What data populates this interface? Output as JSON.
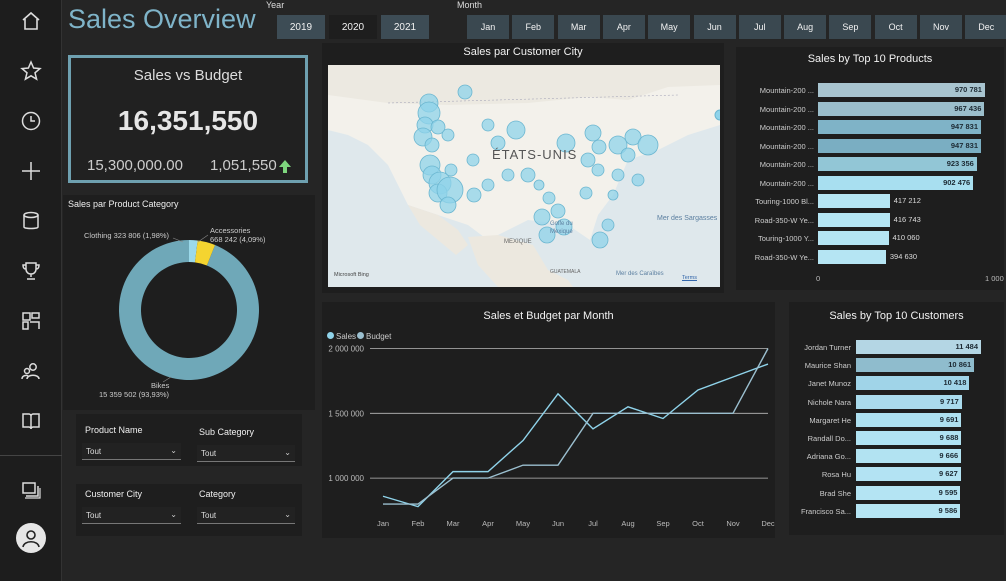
{
  "title": "Sales Overview",
  "filters": {
    "year_label": "Year",
    "years": [
      "2019",
      "2020",
      "2021"
    ],
    "month_label": "Month",
    "months": [
      "Jan",
      "Feb",
      "Mar",
      "Apr",
      "May",
      "Jun",
      "Jul",
      "Aug",
      "Sep",
      "Oct",
      "Nov",
      "Dec"
    ]
  },
  "kpi": {
    "title": "Sales vs Budget",
    "value": "16,351,550",
    "budget": "15,300,000.00",
    "delta": "1,051,550",
    "delta_color": "#7ed67e"
  },
  "map": {
    "title": "Sales par Customer City",
    "country_label": "ÉTATS-UNIS",
    "labels": {
      "mexico": "MEXIQUE",
      "gulf": "Golfe du Mexique",
      "sargasso": "Mer des Sargasses",
      "caribbean": "Mer des Caraïbes",
      "guatemala": "GUATEMALA",
      "brand": "Microsoft Bing",
      "terms": "Terms"
    },
    "bubble_color": "#8fd3ea"
  },
  "donut": {
    "title": "Sales par Product Category",
    "labels": {
      "clothing": "Clothing 323 806 (1,98%)",
      "accessories_name": "Accessories",
      "accessories_value": "668 242 (4,09%)",
      "bikes_name": "Bikes",
      "bikes_value": "15 359 502 (93,93%)"
    }
  },
  "slicers": [
    {
      "label": "Product Name",
      "value": "Tout"
    },
    {
      "label": "Sub Category",
      "value": "Tout"
    },
    {
      "label": "Customer City",
      "value": "Tout"
    },
    {
      "label": "Category",
      "value": "Tout"
    }
  ],
  "line_title": "Sales et Budget par Month",
  "legend": {
    "sales": "Sales",
    "budget": "Budget"
  },
  "top_products": {
    "title": "Sales by Top 10 Products",
    "axis_labels": [
      "0",
      "1 000"
    ]
  },
  "top_customers": {
    "title": "Sales by Top 10 Customers"
  },
  "colors": {
    "accent_bar_dark": "#a8c4cf",
    "accent_bar_light": "#a8dff0",
    "kpi_border": "#6ea0b0",
    "donut_bikes": "#6fa8b8",
    "donut_accessories": "#f4d430",
    "donut_clothing": "#9bd9ea",
    "line_sales": "#8fd3ea",
    "line_budget": "#9bbfcf"
  },
  "chart_data": [
    {
      "type": "pie",
      "title": "Sales par Product Category",
      "categories": [
        "Bikes",
        "Accessories",
        "Clothing"
      ],
      "values": [
        15359502,
        668242,
        323806
      ],
      "percent": [
        93.93,
        4.09,
        1.98
      ]
    },
    {
      "type": "line",
      "title": "Sales et Budget par Month",
      "categories": [
        "Jan",
        "Feb",
        "Mar",
        "Apr",
        "May",
        "Jun",
        "Jul",
        "Aug",
        "Sep",
        "Oct",
        "Nov",
        "Dec"
      ],
      "series": [
        {
          "name": "Sales",
          "values": [
            860000,
            780000,
            1050000,
            1050000,
            1290000,
            1650000,
            1380000,
            1550000,
            1460000,
            1680000,
            1780000,
            1880000
          ]
        },
        {
          "name": "Budget",
          "values": [
            800000,
            800000,
            1000000,
            1000000,
            1100000,
            1100000,
            1500000,
            1500000,
            1500000,
            1500000,
            1500000,
            2000000
          ]
        }
      ],
      "y_ticks": [
        "1 000 000",
        "1 500 000",
        "2 000 000"
      ],
      "y_tick_values": [
        1000000,
        1500000,
        2000000
      ],
      "ylim": [
        700000,
        2050000
      ]
    },
    {
      "type": "bar",
      "title": "Sales by Top 10 Products",
      "categories": [
        "Mountain-200 ...",
        "Mountain-200 ...",
        "Mountain-200 ...",
        "Mountain-200 ...",
        "Mountain-200 ...",
        "Mountain-200 ...",
        "Touring-1000 Bl...",
        "Road-350-W Ye...",
        "Touring-1000 Y...",
        "Road-350-W Ye..."
      ],
      "values": [
        970781,
        967436,
        947831,
        947831,
        923356,
        902476,
        417212,
        416743,
        410060,
        394630
      ],
      "value_labels": [
        "970 781",
        "967 436",
        "947 831",
        "947 831",
        "923 356",
        "902 476",
        "417 212",
        "416 743",
        "410 060",
        "394 630"
      ],
      "xlim": [
        0,
        1000000
      ],
      "x_tick_labels": [
        "0",
        "1 000"
      ]
    },
    {
      "type": "bar",
      "title": "Sales by Top 10 Customers",
      "categories": [
        "Jordan Turner",
        "Maurice Shan",
        "Janet Munoz",
        "Nichole Nara",
        "Margaret He",
        "Randall Do...",
        "Adriana Go...",
        "Rosa Hu",
        "Brad She",
        "Francisco Sa..."
      ],
      "values": [
        11484,
        10861,
        10418,
        9717,
        9691,
        9688,
        9666,
        9627,
        9595,
        9586
      ],
      "value_labels": [
        "11 484",
        "10 861",
        "10 418",
        "9 717",
        "9 691",
        "9 688",
        "9 666",
        "9 627",
        "9 595",
        "9 586"
      ],
      "xlim": [
        0,
        11484
      ]
    }
  ]
}
